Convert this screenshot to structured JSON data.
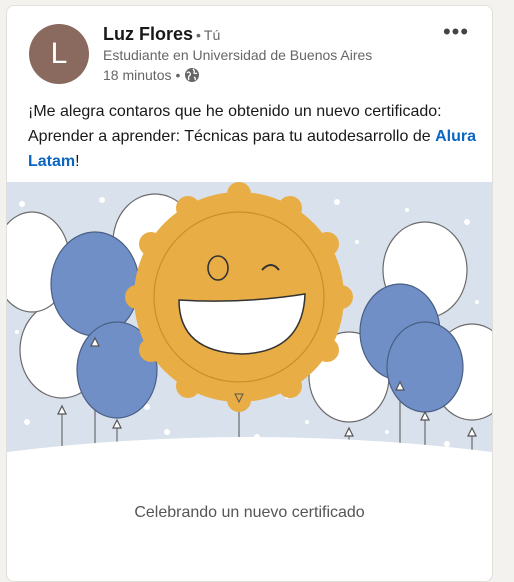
{
  "post": {
    "actor": {
      "initial": "L",
      "name": "Luz Flores",
      "separator": "•",
      "degree": "Tú",
      "headline": "Estudiante en Universidad de Buenos Aires",
      "time": "18 minutos",
      "time_separator": "•",
      "visibility_icon": "globe-icon",
      "avatar_color": "#8a6a5e"
    },
    "more_icon": "ellipsis-icon",
    "more_label": "•••",
    "commentary": {
      "text": "¡Me alegra contaros que he obtenido un nuevo certificado: Aprender a aprender: Técnicas para tu autodesarrollo de ",
      "link": "Alura Latam",
      "end": "!"
    },
    "media_caption": "Celebrando un nuevo certificado",
    "colors": {
      "accent_link": "#0a66c2",
      "balloon_blue": "#6f8fc6",
      "sun_yellow": "#e8ad44",
      "background_blue": "#d9e1ec"
    }
  }
}
